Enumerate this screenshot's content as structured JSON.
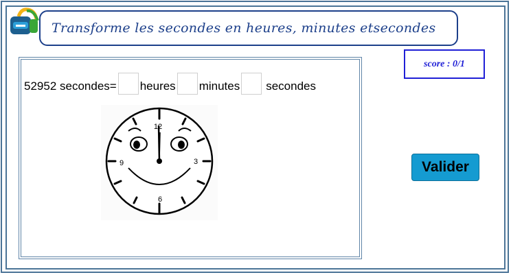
{
  "title": "Transforme les secondes en heures, minutes etsecondes",
  "score": {
    "label": "score : 0/1"
  },
  "question": {
    "prefix": "52952 secondes=",
    "unit_hours": "heures",
    "unit_minutes": "minutes",
    "unit_seconds": "secondes",
    "hours_value": "",
    "minutes_value": "",
    "seconds_value": ""
  },
  "clock": {
    "label_12": "12",
    "label_3": "3",
    "label_6": "6",
    "label_9": "9"
  },
  "buttons": {
    "validate": "Valider"
  },
  "colors": {
    "frame": "#4a7396",
    "title": "#1c3f8a",
    "score": "#1f1fd6",
    "button": "#159bd1"
  },
  "icons": {
    "logo": "school-backpack-icon"
  }
}
